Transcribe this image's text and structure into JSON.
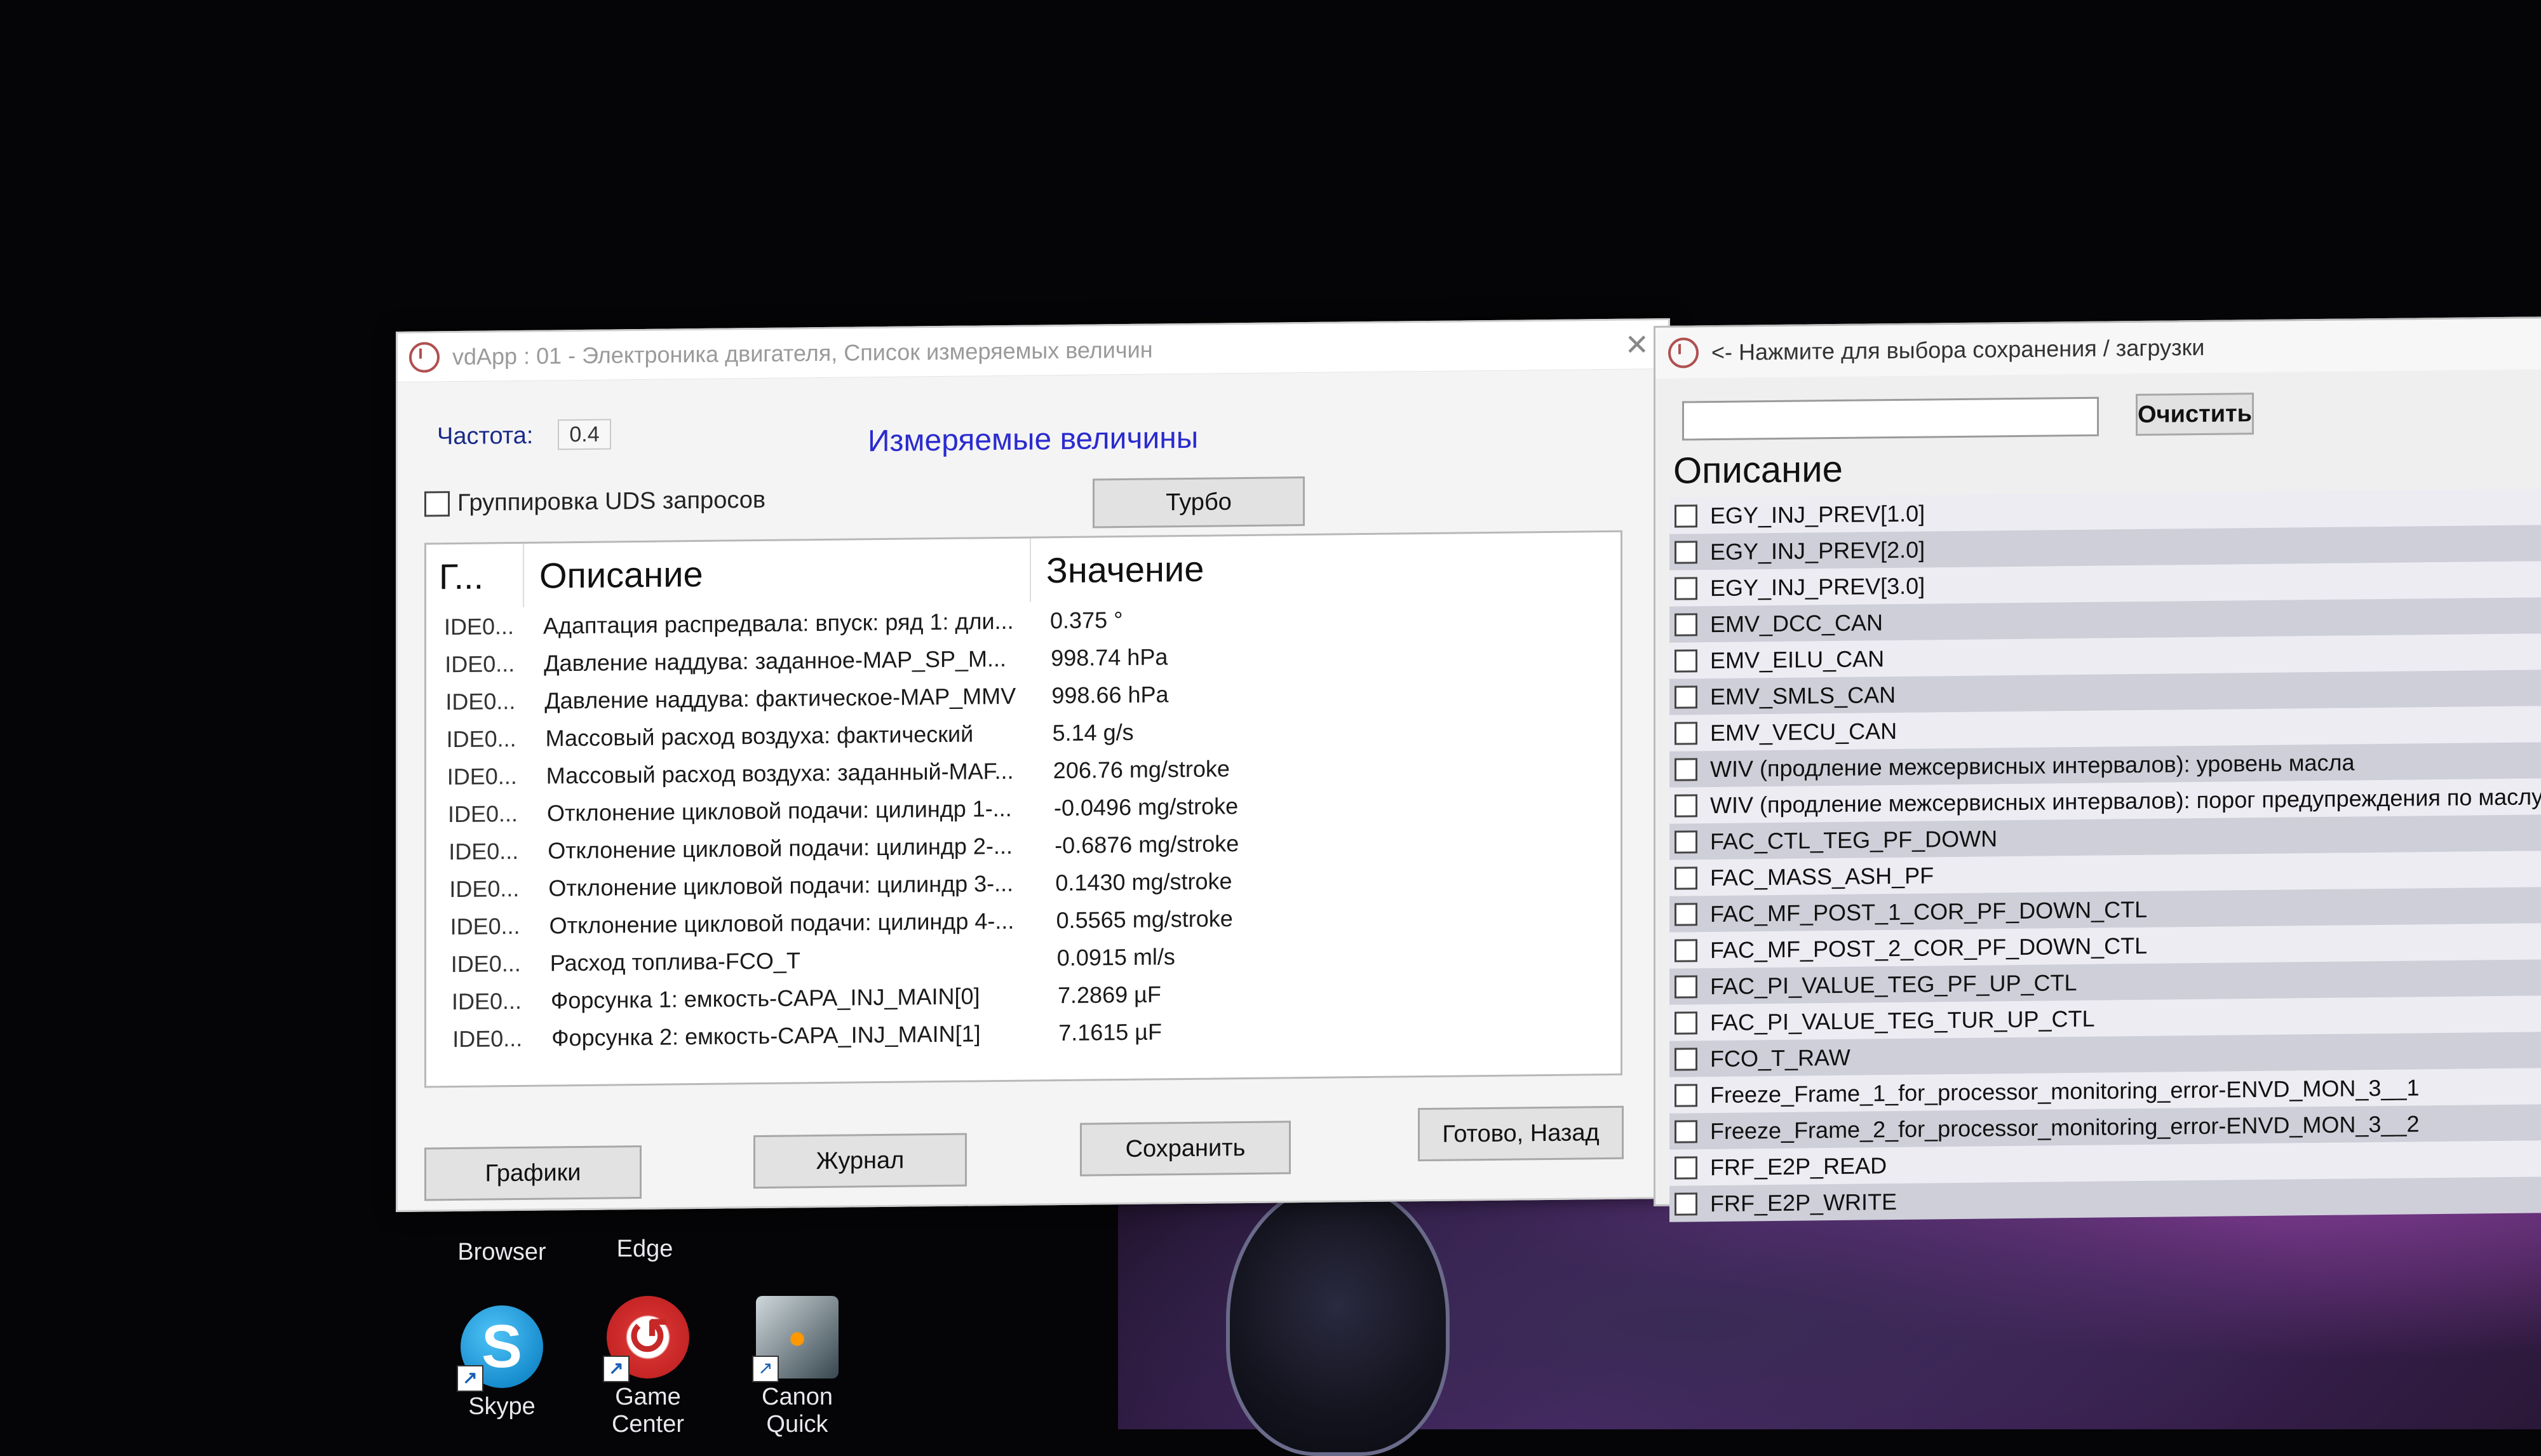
{
  "main_window": {
    "title": "vdApp : 01 - Электроника двигателя,  Список измеряемых величин",
    "frequency_label": "Частота:",
    "frequency_value": "0.4",
    "section_title": "Измеряемые величины",
    "uds_group_label": "Группировка UDS запросов",
    "turbo_label": "Турбо",
    "columns": [
      "Г...",
      "Описание",
      "Значение"
    ],
    "rows": [
      {
        "group": "IDE0...",
        "description": "Адаптация распредвала: впуск: ряд 1: дли...",
        "value": "0.375 °"
      },
      {
        "group": "IDE0...",
        "description": "Давление наддува: заданное-MAP_SP_M...",
        "value": "998.74 hPa"
      },
      {
        "group": "IDE0...",
        "description": "Давление наддува: фактическое-MAP_MMV",
        "value": "998.66 hPa"
      },
      {
        "group": "IDE0...",
        "description": "Массовый расход воздуха: фактический",
        "value": "5.14 g/s"
      },
      {
        "group": "IDE0...",
        "description": "Массовый расход воздуха: заданный-MAF...",
        "value": "206.76 mg/stroke"
      },
      {
        "group": "IDE0...",
        "description": "Отклонение цикловой подачи: цилиндр 1-...",
        "value": "-0.0496 mg/stroke"
      },
      {
        "group": "IDE0...",
        "description": "Отклонение цикловой подачи: цилиндр 2-...",
        "value": "-0.6876 mg/stroke"
      },
      {
        "group": "IDE0...",
        "description": "Отклонение цикловой подачи: цилиндр 3-...",
        "value": "0.1430 mg/stroke"
      },
      {
        "group": "IDE0...",
        "description": "Отклонение цикловой подачи: цилиндр 4-...",
        "value": "0.5565 mg/stroke"
      },
      {
        "group": "IDE0...",
        "description": "Расход топлива-FCO_T",
        "value": "0.0915 ml/s"
      },
      {
        "group": "IDE0...",
        "description": "Форсунка 1: емкость-CAPA_INJ_MAIN[0]",
        "value": "7.2869 µF"
      },
      {
        "group": "IDE0...",
        "description": "Форсунка 2: емкость-CAPA_INJ_MAIN[1]",
        "value": "7.1615 µF"
      }
    ],
    "buttons": {
      "graphs": "Графики",
      "journal": "Журнал",
      "save": "Сохранить",
      "done": "Готово, Назад"
    }
  },
  "right_window": {
    "title": "<- Нажмите для выбора сохранения / загрузки",
    "clear_label": "Очистить",
    "description_header": "Описание",
    "items": [
      "EGY_INJ_PREV[1.0]",
      "EGY_INJ_PREV[2.0]",
      "EGY_INJ_PREV[3.0]",
      "EMV_DCC_CAN",
      "EMV_EILU_CAN",
      "EMV_SMLS_CAN",
      "EMV_VECU_CAN",
      "WIV (продление межсервисных интервалов): уровень масла",
      "WIV (продление межсервисных интервалов): порог предупреждения по маслу",
      "FAC_CTL_TEG_PF_DOWN",
      "FAC_MASS_ASH_PF",
      "FAC_MF_POST_1_COR_PF_DOWN_CTL",
      "FAC_MF_POST_2_COR_PF_DOWN_CTL",
      "FAC_PI_VALUE_TEG_PF_UP_CTL",
      "FAC_PI_VALUE_TEG_TUR_UP_CTL",
      "FCO_T_RAW",
      "Freeze_Frame_1_for_processor_monitoring_error-ENVD_MON_3__1",
      "Freeze_Frame_2_for_processor_monitoring_error-ENVD_MON_3__2",
      "FRF_E2P_READ",
      "FRF_E2P_WRITE"
    ]
  },
  "desktop": {
    "partial_labels": [
      "Browser",
      "Edge"
    ],
    "icons": [
      {
        "label": "Skype",
        "icon": "skype-icon"
      },
      {
        "label": "Game Center",
        "icon": "game-center-icon"
      },
      {
        "label": "Canon Quick",
        "icon": "canon-quick-icon"
      }
    ]
  }
}
